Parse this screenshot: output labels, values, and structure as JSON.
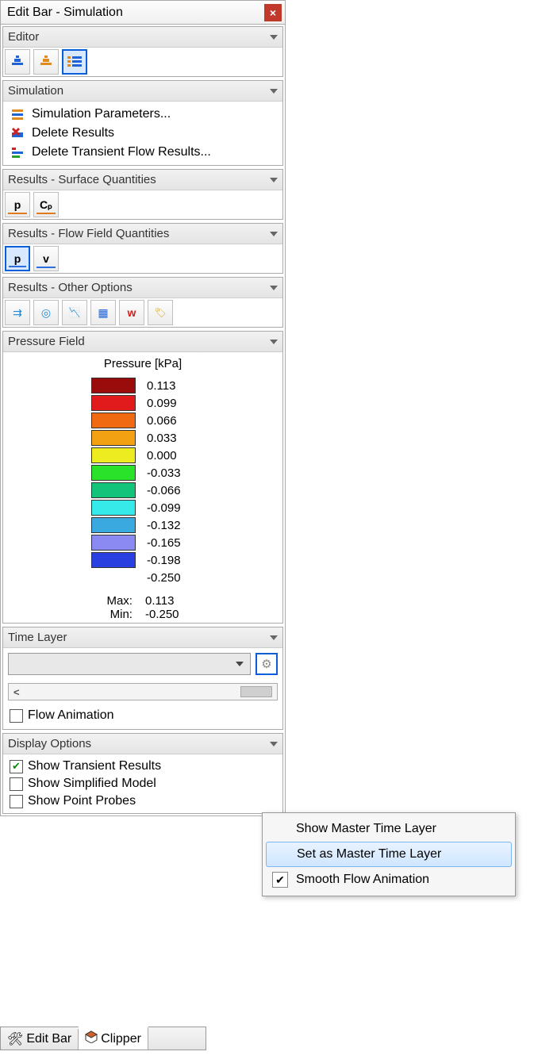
{
  "window": {
    "title": "Edit Bar - Simulation",
    "close_glyph": "×"
  },
  "editor": {
    "header": "Editor",
    "btn1_icon": "stack-blue",
    "btn2_icon": "stack-orange",
    "btn3_icon": "list-orange",
    "selected_index": 2
  },
  "simulation": {
    "header": "Simulation",
    "items": [
      {
        "icon": "params-icon",
        "label": "Simulation Parameters..."
      },
      {
        "icon": "delete-results-icon",
        "label": "Delete Results"
      },
      {
        "icon": "delete-transient-icon",
        "label": "Delete Transient Flow Results..."
      }
    ]
  },
  "results_surface": {
    "header": "Results - Surface Quantities",
    "buttons": [
      {
        "name": "pressure-p",
        "label": "p"
      },
      {
        "name": "pressure-cp",
        "label": "Cₚ"
      }
    ]
  },
  "results_flow": {
    "header": "Results - Flow Field Quantities",
    "buttons": [
      {
        "name": "flow-p",
        "label": "p",
        "selected": true
      },
      {
        "name": "flow-v",
        "label": "v"
      }
    ]
  },
  "results_other": {
    "header": "Results - Other Options",
    "buttons": [
      {
        "name": "streamlines-icon",
        "glyph": "⇉"
      },
      {
        "name": "isosurface-icon",
        "glyph": "◎"
      },
      {
        "name": "graph-icon",
        "glyph": "📉"
      },
      {
        "name": "grid-icon",
        "glyph": "▦"
      },
      {
        "name": "w-icon",
        "glyph": "w"
      },
      {
        "name": "tag-icon",
        "glyph": "🏷"
      }
    ]
  },
  "pressure_field": {
    "header": "Pressure Field",
    "title": "Pressure [kPa]",
    "levels": [
      {
        "color": "#9a0b0b",
        "value": "0.113"
      },
      {
        "color": "#e11b1b",
        "value": "0.099"
      },
      {
        "color": "#f06a12",
        "value": "0.066"
      },
      {
        "color": "#f2a112",
        "value": "0.033"
      },
      {
        "color": "#ecec20",
        "value": "0.000"
      },
      {
        "color": "#29e229",
        "value": "-0.033"
      },
      {
        "color": "#14c37a",
        "value": "-0.066"
      },
      {
        "color": "#36eaea",
        "value": "-0.099"
      },
      {
        "color": "#3aa9e0",
        "value": "-0.132"
      },
      {
        "color": "#8a8af2",
        "value": "-0.165"
      },
      {
        "color": "#2a3fe0",
        "value": "-0.198"
      },
      {
        "color": "",
        "value": "-0.250"
      }
    ],
    "max_label": "Max:",
    "min_label": "Min:",
    "max_value": "0.113",
    "min_value": "-0.250"
  },
  "time_layer": {
    "header": "Time Layer",
    "gear_glyph": "⚙",
    "scroll_left": "<",
    "scroll_right": " ",
    "flow_animation": {
      "checked": false,
      "label": "Flow Animation"
    }
  },
  "display_options": {
    "header": "Display Options",
    "items": [
      {
        "checked": true,
        "label": "Show Transient Results"
      },
      {
        "checked": false,
        "label": "Show Simplified Model"
      },
      {
        "checked": false,
        "label": "Show Point Probes"
      }
    ]
  },
  "context_menu": {
    "items": [
      {
        "label": "Show Master Time Layer",
        "checked": false,
        "hover": false
      },
      {
        "label": "Set as Master Time Layer",
        "checked": false,
        "hover": true
      },
      {
        "label": "Smooth Flow Animation",
        "checked": true,
        "hover": false
      }
    ]
  },
  "tabs": [
    {
      "icon": "tools-icon",
      "label": "Edit Bar",
      "active": false
    },
    {
      "icon": "cube-icon",
      "label": "Clipper",
      "active": true
    }
  ],
  "chart_data": {
    "type": "table",
    "title": "Pressure [kPa] color legend",
    "series": [
      {
        "name": "Pressure",
        "values": [
          0.113,
          0.099,
          0.066,
          0.033,
          0.0,
          -0.033,
          -0.066,
          -0.099,
          -0.132,
          -0.165,
          -0.198,
          -0.25
        ]
      }
    ],
    "colors": [
      "#9a0b0b",
      "#e11b1b",
      "#f06a12",
      "#f2a112",
      "#ecec20",
      "#29e229",
      "#14c37a",
      "#36eaea",
      "#3aa9e0",
      "#8a8af2",
      "#2a3fe0"
    ],
    "max": 0.113,
    "min": -0.25
  }
}
